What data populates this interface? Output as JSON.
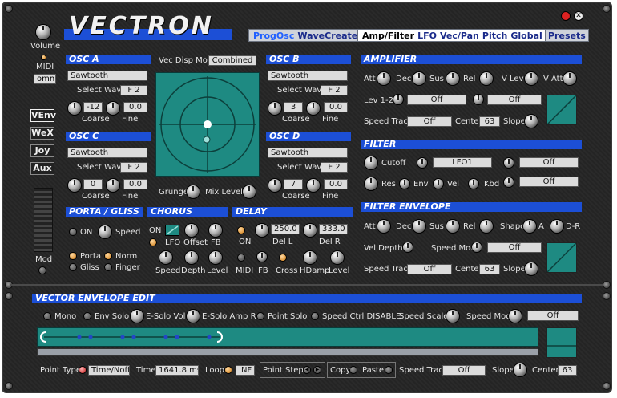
{
  "brand": {
    "name": "VECTRON"
  },
  "header": {
    "tabs_left": [
      "ProgOsc",
      "WaveCreate"
    ],
    "tabs_right": [
      "Amp/Filter",
      "LFO",
      "Vec/Pan",
      "Pitch",
      "Global"
    ],
    "presets": "Presets"
  },
  "global": {
    "volume": "Volume",
    "midi": "MIDI",
    "omni": "omni",
    "mod": "Mod"
  },
  "sidebar": [
    "VEnv",
    "WeX",
    "Joy",
    "Aux"
  ],
  "vecdisp": {
    "label": "Vec Disp Mode",
    "value": "Combined",
    "grunge": "Grunge",
    "mix_level": "Mix Level"
  },
  "osc": {
    "a": {
      "title": "OSC A",
      "wave": "Sawtooth",
      "select_label": "Select Wave",
      "select_value": "F 2",
      "coarse": "-12",
      "fine": "0.0",
      "coarse_label": "Coarse",
      "fine_label": "Fine"
    },
    "b": {
      "title": "OSC B",
      "wave": "Sawtooth",
      "select_label": "Select Wave",
      "select_value": "F 2",
      "coarse": "3",
      "fine": "0.0",
      "coarse_label": "Coarse",
      "fine_label": "Fine"
    },
    "c": {
      "title": "OSC C",
      "wave": "Sawtooth",
      "select_label": "Select Wave",
      "select_value": "F 2",
      "coarse": "0",
      "fine": "0.0",
      "coarse_label": "Coarse",
      "fine_label": "Fine"
    },
    "d": {
      "title": "OSC D",
      "wave": "Sawtooth",
      "select_label": "Select Wave",
      "select_value": "F 2",
      "coarse": "7",
      "fine": "0.0",
      "coarse_label": "Coarse",
      "fine_label": "Fine"
    }
  },
  "porta": {
    "title": "PORTA / GLISS",
    "on": "ON",
    "speed": "Speed",
    "porta": "Porta",
    "norm": "Norm",
    "gliss": "Gliss",
    "finger": "Finger"
  },
  "chorus": {
    "title": "CHORUS",
    "on": "ON",
    "lfo": "LFO",
    "offset": "Offset",
    "fb": "FB",
    "speed": "Speed",
    "depth": "Depth",
    "level": "Level"
  },
  "delay": {
    "title": "DELAY",
    "on": "ON",
    "del_l_value": "250.0",
    "del_r_value": "333.0",
    "del_l": "Del L",
    "del_r": "Del R",
    "midi": "MIDI",
    "fb": "FB",
    "cross": "Cross",
    "hdamp": "HDamp",
    "level": "Level"
  },
  "amplifier": {
    "title": "AMPLIFIER",
    "att": "Att",
    "dec": "Dec",
    "sus": "Sus",
    "rel": "Rel",
    "v_lev": "V Lev",
    "v_att": "V Att",
    "lev12": "Lev 1-2",
    "lev12_value": "Off",
    "lev_value2": "Off",
    "speed_track": "Speed Track",
    "speed_track_value": "Off",
    "center": "Center",
    "center_value": "63",
    "slope": "Slope"
  },
  "filter": {
    "title": "FILTER",
    "cutoff": "Cutoff",
    "src1": "LFO1",
    "src2": "Off",
    "src3": "Off",
    "res": "Res",
    "env": "Env",
    "vel": "Vel",
    "kbd": "Kbd"
  },
  "filter_env": {
    "title": "FILTER ENVELOPE",
    "att": "Att",
    "dec": "Dec",
    "sus": "Sus",
    "rel": "Rel",
    "shape": "Shape",
    "a": "A",
    "dr": "D-R",
    "vel_depth": "Vel Depth",
    "speed_mod": "Speed Mod",
    "speed_mod_value": "Off",
    "speed_track": "Speed Track",
    "speed_track_value": "Off",
    "center": "Center",
    "center_value": "63",
    "slope": "Slope"
  },
  "vector_env": {
    "title": "VECTOR ENVELOPE EDIT",
    "mono": "Mono",
    "env_solo": "Env Solo",
    "esolo_vol": "E-Solo Vol",
    "esolo_amp": "E-Solo Amp R",
    "point_solo": "Point Solo",
    "speed_ctrl": "Speed Ctrl DISABLE",
    "speed_scale": "Speed Scale",
    "speed_mod": "Speed Mod",
    "speed_mod_value": "Off",
    "point_type": "Point Type",
    "point_type_value": "Time/Noff",
    "time": "Time",
    "time_value": "1641.8 ms",
    "loop": "Loop",
    "loop_value": "INF",
    "point_step": "Point Step",
    "copy": "Copy",
    "paste": "Paste",
    "speed_track": "Speed Track",
    "speed_track_value": "Off",
    "slope": "Slope",
    "center": "Center",
    "center_value": "63"
  },
  "colors": {
    "accent": "#1c4fd6",
    "teal": "#1e8a82",
    "panel": "#262626"
  }
}
